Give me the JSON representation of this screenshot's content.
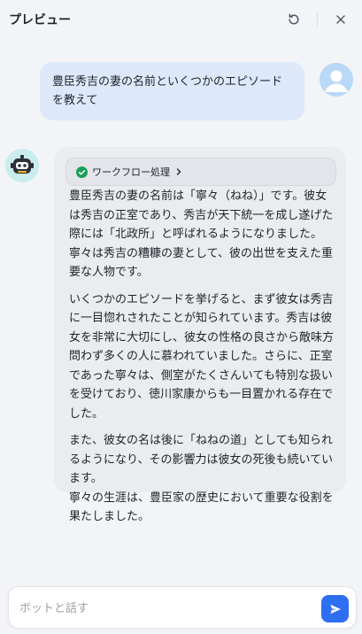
{
  "header": {
    "title": "プレビュー",
    "refresh_icon": "refresh-icon",
    "close_icon": "close-icon"
  },
  "user_message": {
    "text": "豊臣秀吉の妻の名前といくつかのエピソードを教えて",
    "avatar_icon": "user-avatar-icon"
  },
  "bot_message": {
    "avatar_icon": "bot-avatar-icon",
    "workflow_label": "ワークフロー処理",
    "workflow_status_icon": "check-circle-icon",
    "workflow_status_color": "#18a058",
    "paragraphs": [
      "豊臣秀吉の妻の名前は「寧々（ねね）」です。彼女は秀吉の正室であり、秀吉が天下統一を成し遂げた際には「北政所」と呼ばれるようになりました。寧々は秀吉の糟糠の妻として、彼の出世を支えた重要な人物です。",
      "いくつかのエピソードを挙げると、まず彼女は秀吉に一目惚れされたことが知られています。秀吉は彼女を非常に大切にし、彼女の性格の良さから敵味方問わず多くの人に慕われていました。さらに、正室であった寧々は、側室がたくさんいても特別な扱いを受けており、徳川家康からも一目置かれる存在でした。",
      "また、彼女の名は後に「ねねの道」としても知られるようになり、その影響力は彼女の死後も続いています。",
      "寧々の生涯は、豊臣家の歴史において重要な役割を果たしました。"
    ]
  },
  "input": {
    "placeholder": "ボットと話す",
    "value": "",
    "send_icon": "send-icon",
    "send_color": "#2e6ef1"
  }
}
